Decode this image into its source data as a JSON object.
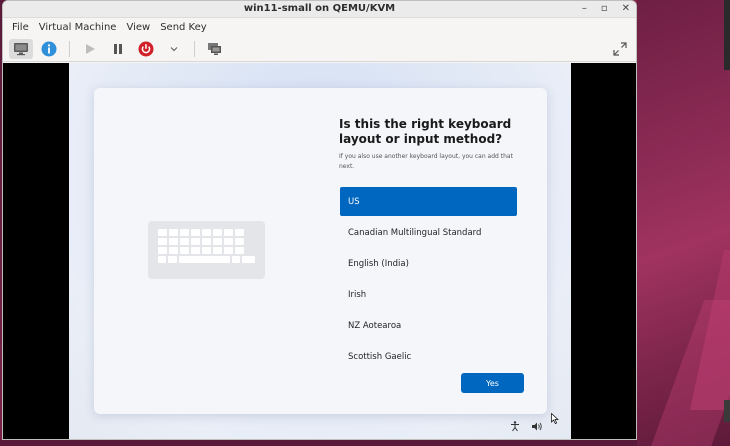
{
  "window": {
    "title": "win11-small on QEMU/KVM",
    "controls": [
      "–",
      "▫",
      "✕"
    ]
  },
  "menu": [
    "File",
    "Virtual Machine",
    "View",
    "Send Key"
  ],
  "toolbar": {
    "icons": [
      "monitor-icon",
      "info-icon",
      "play-icon",
      "pause-icon",
      "power-icon",
      "chevron-down-icon",
      "screenshot-icon",
      "fullscreen-icon"
    ],
    "power_color": "#d0212b",
    "info_color": "#2f8fd8"
  },
  "setup": {
    "heading": "Is this the right keyboard layout or input method?",
    "subtext": "If you also use another keyboard layout, you can add that next.",
    "layouts": [
      "US",
      "Canadian Multilingual Standard",
      "English (India)",
      "Irish",
      "NZ Aotearoa",
      "Scottish Gaelic"
    ],
    "selected_layout": "US",
    "yes_label": "Yes",
    "accent": "#0067c0"
  }
}
